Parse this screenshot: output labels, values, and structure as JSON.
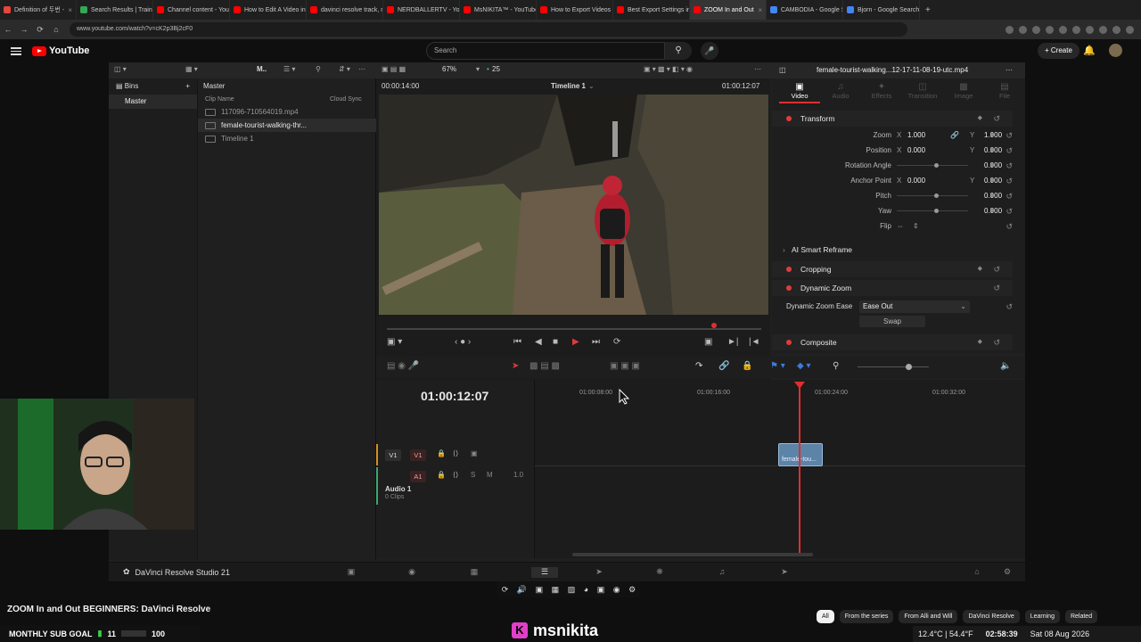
{
  "browser": {
    "tabs": [
      {
        "label": "Definition of 두번 - ",
        "active": false,
        "color": "#e8453c"
      },
      {
        "label": "Search Results | Traini",
        "active": false,
        "color": "#34a853"
      },
      {
        "label": "Channel content - You",
        "active": false,
        "color": "#ff0000"
      },
      {
        "label": "How to Edit A Video in",
        "active": false,
        "color": "#ff0000"
      },
      {
        "label": "davinci resolve track, m",
        "active": false,
        "color": "#ff0000"
      },
      {
        "label": "NERDBALLERTV - YouT",
        "active": false,
        "color": "#ff0000"
      },
      {
        "label": "MsNIKITA™ - YouTube",
        "active": false,
        "color": "#ff0000"
      },
      {
        "label": "How to Export Videos",
        "active": false,
        "color": "#ff0000"
      },
      {
        "label": "Best Export Settings in",
        "active": false,
        "color": "#ff0000"
      },
      {
        "label": "ZOOM In and Out",
        "active": true,
        "color": "#ff0000"
      },
      {
        "label": "CAMBODIA - Google S",
        "active": false,
        "color": "#4285f4"
      },
      {
        "label": "Bjorn - Google Search",
        "active": false,
        "color": "#4285f4"
      }
    ],
    "url": "www.youtube.com/watch?v=cK2p3Bj2cF0"
  },
  "youtube": {
    "logo_text": "YouTube",
    "search_placeholder": "Search",
    "create_label": "Create",
    "video_title": "ZOOM In and Out BEGINNERS: DaVinci Resolve",
    "chips": [
      "All",
      "From the series",
      "From Alli and Will",
      "DaVinci Resolve",
      "Learning",
      "Related"
    ]
  },
  "resolve": {
    "zoom_pct": "67%",
    "fps": "25",
    "bins_label": "Bins",
    "master_label": "Master",
    "master_bin": "Master",
    "clip_name_header": "Clip Name",
    "cloud_sync": "Cloud Sync",
    "clips": [
      {
        "name": "117096-710564019.mp4",
        "selected": false
      },
      {
        "name": "female-tourist-walking-thr...",
        "selected": true
      },
      {
        "name": "Timeline 1",
        "selected": false
      }
    ],
    "viewer_tc_left": "00:00:14:00",
    "timeline_name": "Timeline 1",
    "viewer_tc_right": "01:00:12:07",
    "inspector_file": "female-tourist-walking...12-17-11-08-19-utc.mp4",
    "inspector_tabs": [
      "Video",
      "Audio",
      "Effects",
      "Transition",
      "Image",
      "File"
    ],
    "transform": {
      "title": "Transform",
      "zoom_label": "Zoom",
      "zoom_x": "1.000",
      "zoom_y": "1.000",
      "position_label": "Position",
      "pos_x": "0.000",
      "pos_y": "0.000",
      "rotation_label": "Rotation Angle",
      "rotation": "0.000",
      "anchor_label": "Anchor Point",
      "anchor_x": "0.000",
      "anchor_y": "0.000",
      "pitch_label": "Pitch",
      "pitch": "0.000",
      "yaw_label": "Yaw",
      "yaw": "0.000",
      "flip_label": "Flip"
    },
    "ai_reframe": "AI Smart Reframe",
    "cropping": "Cropping",
    "dynamic_zoom": "Dynamic Zoom",
    "dz_ease_label": "Dynamic Zoom Ease",
    "dz_ease_value": "Ease Out",
    "swap_label": "Swap",
    "composite": "Composite",
    "timeline_tc": "01:00:12:07",
    "ruler_labels": [
      "01:00:08:00",
      "01:00:16:00",
      "01:00:24:00",
      "01:00:32:00"
    ],
    "v1_label": "V1",
    "a1_label": "A1",
    "audio_track_name": "Audio 1",
    "audio_clips": "0 Clips",
    "audio_level": "1.0",
    "clip_label": "female-tou...",
    "app_title": "DaVinci Resolve Studio 21"
  },
  "overlays": {
    "sub_goal_label": "MONTHLY SUB GOAL",
    "sub_goal_current": "11",
    "sub_goal_target": "100",
    "kick_name": "msnikita"
  },
  "taskbar": {
    "temp": "12.4°C | 54.4°F",
    "time": "02:58:39",
    "date": "Sat 08 Aug 2026"
  }
}
